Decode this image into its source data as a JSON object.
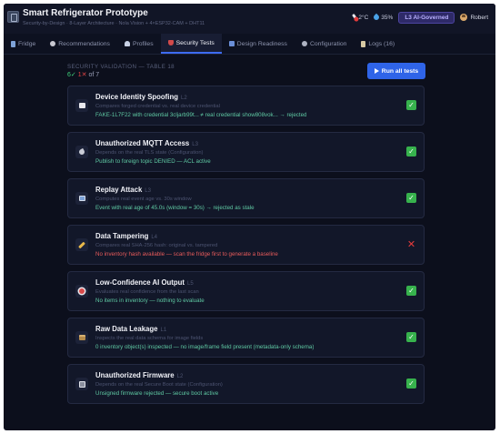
{
  "app": {
    "title": "Smart Refrigerator Prototype",
    "subtitle": "Security-by-Design · 8-Layer Architecture · Nola Vision + 4×ESP32-CAM + DHT11"
  },
  "header": {
    "temperature": "2°C",
    "humidity": "35%",
    "level_badge": "L3 AI-Governed",
    "user_name": "Robert"
  },
  "tabs": [
    {
      "label": "Fridge",
      "icon": "fridge-icon"
    },
    {
      "label": "Recommendations",
      "icon": "recommendations-icon"
    },
    {
      "label": "Profiles",
      "icon": "profiles-icon"
    },
    {
      "label": "Security Tests",
      "icon": "shield-icon",
      "active": true
    },
    {
      "label": "Design Readiness",
      "icon": "chart-icon"
    },
    {
      "label": "Configuration",
      "icon": "gear-icon"
    },
    {
      "label": "Logs (16)",
      "icon": "logs-icon"
    }
  ],
  "validation": {
    "section_label": "SECURITY VALIDATION — TABLE 18",
    "passed": "6✓",
    "failed": "1✕",
    "total": "of 7",
    "run_button": "Run all tests"
  },
  "tests": [
    {
      "title": "Device Identity Spoofing",
      "level": "L2",
      "description": "Compares forged credential vs. real device credential",
      "result": "FAKE-1L7F22 with credential 3cljarb99t... ≠ real credential show808vok... → rejected",
      "status": "pass",
      "icon": "envelope-icon"
    },
    {
      "title": "Unauthorized MQTT Access",
      "level": "L3",
      "description": "Depends on the real TLS state (Configuration)",
      "result": "Publish to foreign topic DENIED — ACL active",
      "status": "pass",
      "icon": "satellite-icon"
    },
    {
      "title": "Replay Attack",
      "level": "L3",
      "description": "Computes real event age vs. 30s window",
      "result": "Event with real age of 45.0s (window = 30s) → rejected as stale",
      "status": "pass",
      "icon": "replay-icon"
    },
    {
      "title": "Data Tampering",
      "level": "L4",
      "description": "Compares real SHA-256 hash: original vs. tampered",
      "result": "No inventory hash available — scan the fridge first to generate a baseline",
      "status": "fail",
      "icon": "pencil-icon"
    },
    {
      "title": "Low-Confidence AI Output",
      "level": "L5",
      "description": "Evaluates real confidence from the last scan",
      "result": "No items in inventory — nothing to evaluate",
      "status": "pass",
      "icon": "target-icon"
    },
    {
      "title": "Raw Data Leakage",
      "level": "L1",
      "description": "Inspects the real data schema for image fields",
      "result": "0 inventory object(s) inspected — no image/frame field present (metadata-only schema)",
      "status": "pass",
      "icon": "box-icon"
    },
    {
      "title": "Unauthorized Firmware",
      "level": "L2",
      "description": "Depends on the real Secure Boot state (Configuration)",
      "result": "Unsigned firmware rejected — secure boot active",
      "status": "pass",
      "icon": "floppy-icon"
    }
  ],
  "status_glyphs": {
    "pass": "✓",
    "fail": "✕"
  }
}
